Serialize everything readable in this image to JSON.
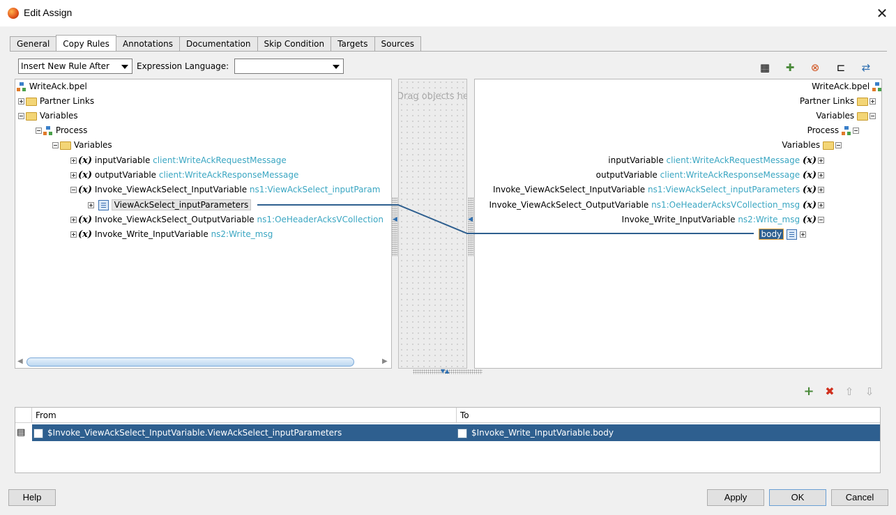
{
  "window": {
    "title": "Edit Assign"
  },
  "tabs": [
    "General",
    "Copy Rules",
    "Annotations",
    "Documentation",
    "Skip Condition",
    "Targets",
    "Sources"
  ],
  "active_tab": "Copy Rules",
  "toolbar": {
    "insert_mode": "Insert New Rule After",
    "expression_language_label": "Expression Language:",
    "expression_language_value": ""
  },
  "source_tree": {
    "root": "WriteAck.bpel",
    "partner_links": "Partner Links",
    "variables": "Variables",
    "process": "Process",
    "process_variables": "Variables",
    "items": [
      {
        "name": "inputVariable",
        "type": "client:WriteAckRequestMessage"
      },
      {
        "name": "outputVariable",
        "type": "client:WriteAckResponseMessage"
      },
      {
        "name": "Invoke_ViewAckSelect_InputVariable",
        "type": "ns1:ViewAckSelect_inputParam"
      },
      {
        "name": "ViewAckSelect_inputParameters",
        "type": ""
      },
      {
        "name": "Invoke_ViewAckSelect_OutputVariable",
        "type": "ns1:OeHeaderAcksVCollection"
      },
      {
        "name": "Invoke_Write_InputVariable",
        "type": "ns2:Write_msg"
      }
    ]
  },
  "drag_area_text": "Drag objects here",
  "target_tree": {
    "root": "WriteAck.bpel",
    "partner_links": "Partner Links",
    "variables": "Variables",
    "process": "Process",
    "process_variables": "Variables",
    "items": [
      {
        "name": "inputVariable",
        "type": "client:WriteAckRequestMessage"
      },
      {
        "name": "outputVariable",
        "type": "client:WriteAckResponseMessage"
      },
      {
        "name": "Invoke_ViewAckSelect_InputVariable",
        "type": "ns1:ViewAckSelect_inputParameters"
      },
      {
        "name": "Invoke_ViewAckSelect_OutputVariable",
        "type": "ns1:OeHeaderAcksVCollection_msg"
      },
      {
        "name": "Invoke_Write_InputVariable",
        "type": "ns2:Write_msg"
      },
      {
        "name": "body",
        "type": ""
      }
    ]
  },
  "rules_table": {
    "columns": [
      "From",
      "To"
    ],
    "rows": [
      {
        "from": "$Invoke_ViewAckSelect_InputVariable.ViewAckSelect_inputParameters",
        "to": "$Invoke_Write_InputVariable.body"
      }
    ]
  },
  "buttons": {
    "help": "Help",
    "apply": "Apply",
    "ok": "OK",
    "cancel": "Cancel"
  },
  "colors": {
    "accent": "#2e5f8f",
    "type_text": "#3aa6c2",
    "mapping_line": "#2e5f8f"
  }
}
